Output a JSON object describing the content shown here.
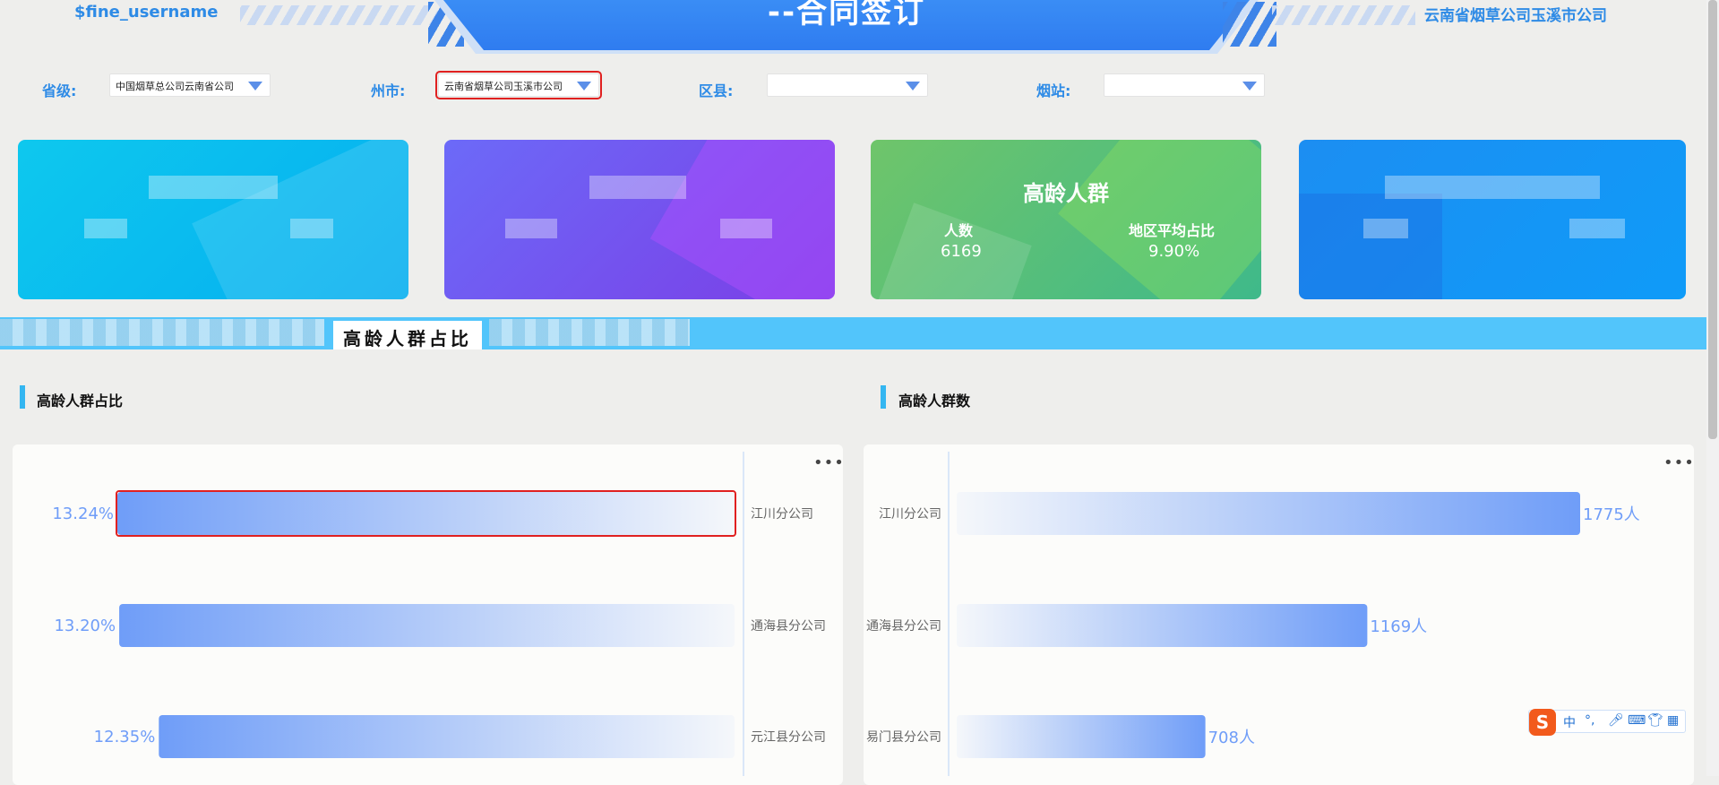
{
  "header": {
    "username": "$fine_username",
    "title": "--合同签订",
    "company": "云南省烟草公司玉溪市公司"
  },
  "filters": {
    "province_label": "省级:",
    "province_value": "中国烟草总公司云南省公司",
    "city_label": "州市:",
    "city_value": "云南省烟草公司玉溪市公司",
    "county_label": "区县:",
    "county_value": "",
    "station_label": "烟站:",
    "station_value": ""
  },
  "cards": {
    "elderly": {
      "title": "高龄人群",
      "count_label": "人数",
      "count_value": "6169",
      "ratio_label": "地区平均占比",
      "ratio_value": "9.90%"
    }
  },
  "tabs": {
    "active": "高龄人群占比"
  },
  "sections": {
    "left_title": "高龄人群占比",
    "right_title": "高龄人群数"
  },
  "ime": {
    "mode": "中",
    "punct": "°,"
  },
  "colors": {
    "accent": "#2e8be6",
    "tabstrip": "#52c5fb",
    "bar_blue": "#6f9df8",
    "card_cyan": "#06b4ee",
    "card_purple": "#7a5cf0",
    "card_green": "#55bf7a",
    "card_blue": "#1a93f5"
  },
  "chart_data": [
    {
      "type": "bar",
      "orientation": "horizontal",
      "categories": [
        "江川分公司",
        "通海县分公司",
        "元江县分公司"
      ],
      "values": [
        13.24,
        13.2,
        12.35
      ],
      "value_labels": [
        "13.24%",
        "13.20%",
        "12.35%"
      ],
      "xlim": [
        0,
        13.24
      ]
    },
    {
      "type": "bar",
      "orientation": "horizontal",
      "categories": [
        "江川分公司",
        "通海县分公司",
        "易门县分公司"
      ],
      "values": [
        1775,
        1169,
        708
      ],
      "value_labels": [
        "1775人",
        "1169人",
        "708人"
      ],
      "xlim": [
        0,
        1775
      ]
    }
  ]
}
